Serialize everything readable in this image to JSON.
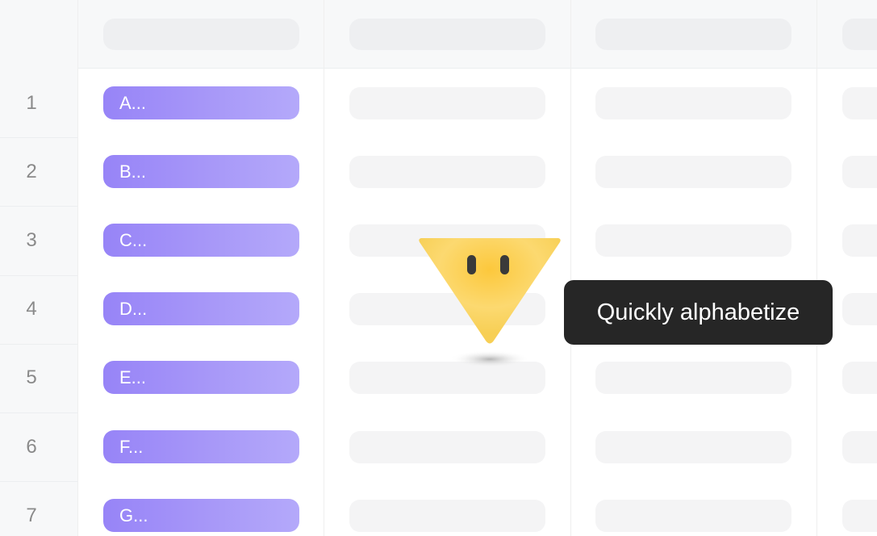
{
  "rows": [
    {
      "number": "1",
      "tag": "A..."
    },
    {
      "number": "2",
      "tag": "B..."
    },
    {
      "number": "3",
      "tag": "C..."
    },
    {
      "number": "4",
      "tag": "D..."
    },
    {
      "number": "5",
      "tag": "E..."
    },
    {
      "number": "6",
      "tag": "F..."
    },
    {
      "number": "7",
      "tag": "G..."
    }
  ],
  "tooltip": {
    "text": "Quickly alphabetize"
  },
  "mascot": {
    "icon": "triangle-mascot-icon"
  },
  "colors": {
    "tag_start": "#9784f7",
    "tag_end": "#b4a9fa",
    "tooltip_bg": "#262626",
    "mascot": "#fbd35a"
  }
}
